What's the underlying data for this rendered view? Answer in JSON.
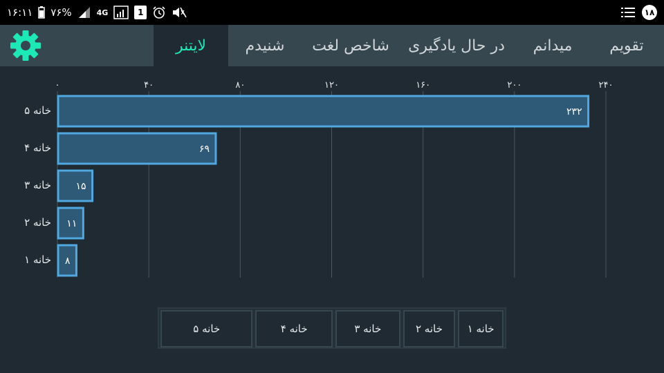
{
  "status_bar": {
    "time": "۱۶:۱۱",
    "battery": "۷۶%",
    "network": "4G",
    "sim": "1",
    "notification_count": "۱۸"
  },
  "tabs": [
    {
      "label": "تقویم",
      "active": false
    },
    {
      "label": "میدانم",
      "active": false
    },
    {
      "label": "در حال یادگیری",
      "active": false
    },
    {
      "label": "شاخص لغت",
      "active": false
    },
    {
      "label": "شنیدم",
      "active": false
    },
    {
      "label": "لایتنر",
      "active": true
    }
  ],
  "colors": {
    "accent": "#1de9b6",
    "bar_fill": "#2f5a77",
    "bar_stroke": "#4fa8e0",
    "grid": "#4a5860",
    "background": "#1f2a32"
  },
  "chart_data": {
    "type": "bar",
    "orientation": "horizontal",
    "categories": [
      "خانه ۵",
      "خانه ۴",
      "خانه ۳",
      "خانه ۲",
      "خانه ۱"
    ],
    "values": [
      232,
      69,
      15,
      11,
      8
    ],
    "value_labels": [
      "۲۳۲",
      "۶۹",
      "۱۵",
      "۱۱",
      "۸"
    ],
    "x_ticks": [
      0,
      40,
      80,
      120,
      160,
      200,
      240
    ],
    "x_tick_labels": [
      "۰",
      "۴۰",
      "۸۰",
      "۱۲۰",
      "۱۶۰",
      "۲۰۰",
      "۲۴۰"
    ],
    "xlim": [
      0,
      240
    ],
    "grid": true
  },
  "legend": {
    "items": [
      "خانه ۱",
      "خانه ۲",
      "خانه ۳",
      "خانه ۴",
      "خانه ۵"
    ]
  }
}
